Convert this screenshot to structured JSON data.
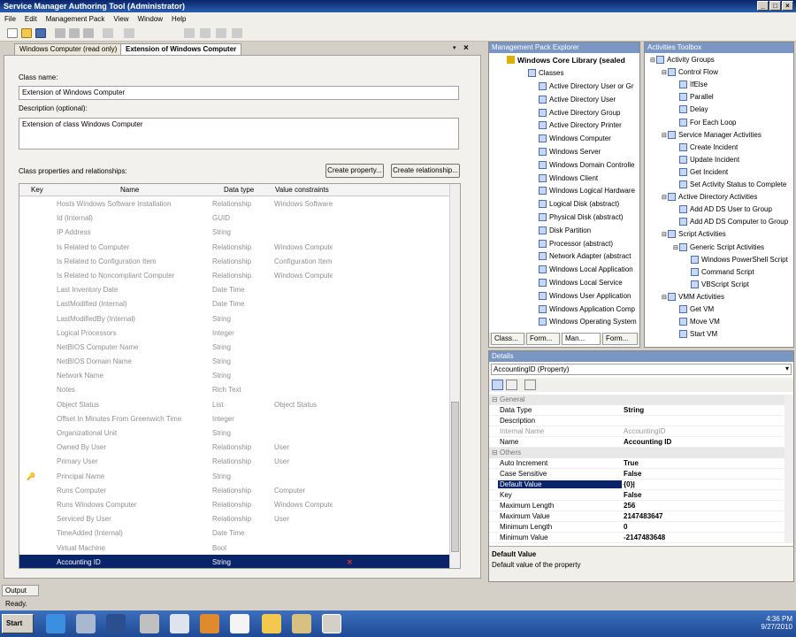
{
  "window": {
    "title": "Service Manager Authoring Tool (Administrator)"
  },
  "menu": [
    "File",
    "Edit",
    "Management Pack",
    "View",
    "Window",
    "Help"
  ],
  "tabs": [
    {
      "label": "Windows Computer (read only)"
    },
    {
      "label": "Extension of Windows Computer"
    }
  ],
  "form": {
    "class_name_label": "Class name:",
    "class_name_value": "Extension of Windows Computer",
    "description_label": "Description (optional):",
    "description_value": "Extension of class Windows Computer",
    "props_label": "Class properties and relationships:",
    "create_property": "Create property...",
    "create_relationship": "Create relationship..."
  },
  "grid": {
    "headers": {
      "key": "Key",
      "name": "Name",
      "type": "Data type",
      "constraints": "Value constraints"
    },
    "rows": [
      {
        "name": "Hosts Windows Software Installation",
        "type": "Relationship",
        "constraint": "Windows Software"
      },
      {
        "name": "Id (Internal)",
        "type": "GUID",
        "constraint": ""
      },
      {
        "name": "IP Address",
        "type": "String",
        "constraint": ""
      },
      {
        "name": "Is Related to Computer",
        "type": "Relationship",
        "constraint": "Windows Compute"
      },
      {
        "name": "Is Related to Configuration Item",
        "type": "Relationship",
        "constraint": "Configuration Item"
      },
      {
        "name": "Is Related to Noncompliant Computer",
        "type": "Relationship",
        "constraint": "Windows Compute"
      },
      {
        "name": "Last Inventory Date",
        "type": "Date Time",
        "constraint": ""
      },
      {
        "name": "LastModified (Internal)",
        "type": "Date Time",
        "constraint": ""
      },
      {
        "name": "LastModifiedBy (Internal)",
        "type": "String",
        "constraint": ""
      },
      {
        "name": "Logical Processors",
        "type": "Integer",
        "constraint": ""
      },
      {
        "name": "NetBIOS Computer Name",
        "type": "String",
        "constraint": ""
      },
      {
        "name": "NetBIOS Domain Name",
        "type": "String",
        "constraint": ""
      },
      {
        "name": "Network Name",
        "type": "String",
        "constraint": ""
      },
      {
        "name": "Notes",
        "type": "Rich Text",
        "constraint": ""
      },
      {
        "name": "Object Status",
        "type": "List",
        "constraint": "Object Status"
      },
      {
        "name": "Offset In Minutes From Greenwich Time",
        "type": "Integer",
        "constraint": ""
      },
      {
        "name": "Organizational Unit",
        "type": "String",
        "constraint": ""
      },
      {
        "name": "Owned By User",
        "type": "Relationship",
        "constraint": "User"
      },
      {
        "name": "Primary User",
        "type": "Relationship",
        "constraint": "User"
      },
      {
        "name": "Principal Name",
        "type": "String",
        "constraint": "",
        "key": true
      },
      {
        "name": "Runs Computer",
        "type": "Relationship",
        "constraint": "Computer"
      },
      {
        "name": "Runs Windows Computer",
        "type": "Relationship",
        "constraint": "Windows Compute"
      },
      {
        "name": "Serviced By User",
        "type": "Relationship",
        "constraint": "User"
      },
      {
        "name": "TimeAdded (Internal)",
        "type": "Date Time",
        "constraint": ""
      },
      {
        "name": "Virtual Machine",
        "type": "Bool",
        "constraint": ""
      },
      {
        "name": "Accounting ID",
        "type": "String",
        "constraint": "",
        "selected": true
      }
    ]
  },
  "mp_explorer": {
    "title": "Management Pack Explorer",
    "root": "Windows Core Library (sealed",
    "classes_label": "Classes",
    "items": [
      "Active Directory User or Gr",
      "Active Directory User",
      "Active Directory Group",
      "Active Directory Printer",
      "Windows Computer",
      "Windows Server",
      "Windows Domain Controlle",
      "Windows Client",
      "Windows Logical Hardware",
      "Logical Disk (abstract)",
      "Physical Disk (abstract)",
      "Disk Partition",
      "Processor (abstract)",
      "Network Adapter (abstract",
      "Windows Local Application",
      "Windows Local Service",
      "Windows User Application",
      "Windows Application Comp",
      "Windows Operating System"
    ],
    "bottom_tabs": [
      "Class...",
      "Form...",
      "Man...",
      "Form..."
    ]
  },
  "toolbox": {
    "title": "Activities Toolbox",
    "items": [
      {
        "label": "Activity Groups",
        "level": 0
      },
      {
        "label": "Control Flow",
        "level": 1
      },
      {
        "label": "IfElse",
        "level": 2
      },
      {
        "label": "Parallel",
        "level": 2
      },
      {
        "label": "Delay",
        "level": 2
      },
      {
        "label": "For Each Loop",
        "level": 2
      },
      {
        "label": "Service Manager Activities",
        "level": 1
      },
      {
        "label": "Create Incident",
        "level": 2
      },
      {
        "label": "Update Incident",
        "level": 2
      },
      {
        "label": "Get Incident",
        "level": 2
      },
      {
        "label": "Set Activity Status to Complete",
        "level": 2
      },
      {
        "label": "Active Directory Activities",
        "level": 1
      },
      {
        "label": "Add AD DS User to Group",
        "level": 2
      },
      {
        "label": "Add AD DS Computer to Group",
        "level": 2
      },
      {
        "label": "Script Activities",
        "level": 1
      },
      {
        "label": "Generic Script Activities",
        "level": 2
      },
      {
        "label": "Windows PowerShell Script",
        "level": 3
      },
      {
        "label": "Command Script",
        "level": 3
      },
      {
        "label": "VBScript Script",
        "level": 3
      },
      {
        "label": "VMM Activities",
        "level": 1
      },
      {
        "label": "Get VM",
        "level": 2
      },
      {
        "label": "Move VM",
        "level": 2
      },
      {
        "label": "Start VM",
        "level": 2
      }
    ]
  },
  "details": {
    "title": "Details",
    "selector": "AccountingID (Property)",
    "rows": [
      {
        "cat": "General"
      },
      {
        "name": "Data Type",
        "value": "String"
      },
      {
        "name": "Description",
        "value": ""
      },
      {
        "name": "Internal Name",
        "value": "AccountingID",
        "dim": true
      },
      {
        "name": "Name",
        "value": "Accounting ID"
      },
      {
        "cat": "Others"
      },
      {
        "name": "Auto Increment",
        "value": "True"
      },
      {
        "name": "Case Sensitive",
        "value": "False"
      },
      {
        "name": "Default Value",
        "value": "{0}|",
        "sel": true
      },
      {
        "name": "Key",
        "value": "False"
      },
      {
        "name": "Maximum Length",
        "value": "256"
      },
      {
        "name": "Maximum Value",
        "value": "2147483647"
      },
      {
        "name": "Minimum Length",
        "value": "0"
      },
      {
        "name": "Minimum Value",
        "value": "-2147483648"
      }
    ],
    "help_title": "Default Value",
    "help_text": "Default value of the property"
  },
  "output_tab": "Output",
  "status": "Ready.",
  "taskbar": {
    "start": "Start",
    "time": "4:36 PM",
    "date": "9/27/2010"
  }
}
